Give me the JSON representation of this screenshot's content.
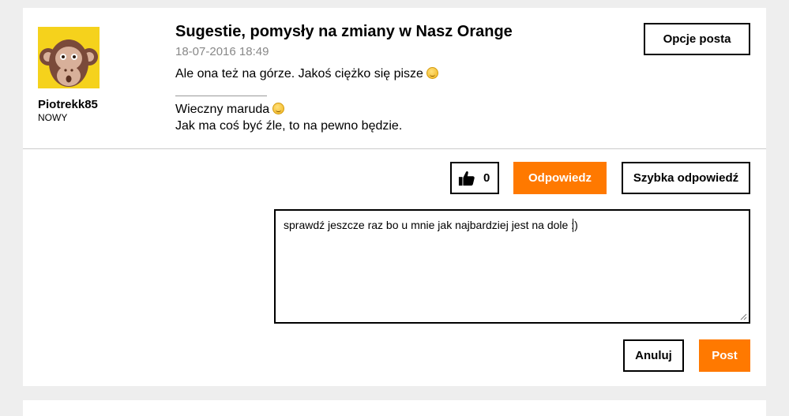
{
  "post": {
    "author": {
      "username": "Piotrekk85",
      "rank": "NOWY",
      "avatar_icon": "monkey-avatar-icon"
    },
    "title": "Sugestie, pomysły na zmiany w Nasz Orange",
    "date": "18-07-2016 18:49",
    "body": "Ale ona też na górze. Jakoś ciężko się pisze",
    "signature": {
      "line1": "Wieczny maruda",
      "line2": "Jak ma coś być źle, to na pewno będzie."
    },
    "options_label": "Opcje posta"
  },
  "actions": {
    "like_icon": "thumbs-up-icon",
    "like_count": "0",
    "reply_label": "Odpowiedz",
    "quick_reply_label": "Szybka odpowiedź"
  },
  "reply_form": {
    "text": "sprawdź jeszcze raz bo u mnie jak najbardziej jest na dole :)",
    "cancel_label": "Anuluj",
    "post_label": "Post"
  },
  "colors": {
    "accent": "#ff7900",
    "avatar_bg": "#f5d21c",
    "background": "#eeeeee"
  }
}
